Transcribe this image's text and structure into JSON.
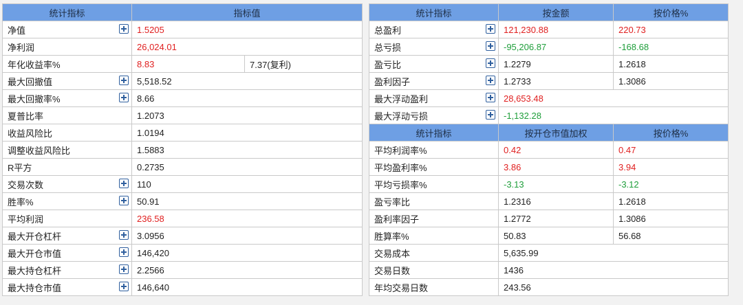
{
  "left": {
    "header": [
      "统计指标",
      "指标值"
    ],
    "rows": [
      {
        "label": "净值",
        "value": "1.5205",
        "color": "red",
        "expand": true
      },
      {
        "label": "净利润",
        "value": "26,024.01",
        "color": "red",
        "expand": false
      },
      {
        "label": "年化收益率%",
        "value": "8.83",
        "value2": "7.37(复利)",
        "color": "red",
        "expand": false
      },
      {
        "label": "最大回撤值",
        "value": "5,518.52",
        "expand": true
      },
      {
        "label": "最大回撤率%",
        "value": "8.66",
        "expand": true
      },
      {
        "label": "夏普比率",
        "value": "1.2073",
        "expand": false
      },
      {
        "label": "收益风险比",
        "value": "1.0194",
        "expand": false
      },
      {
        "label": "调整收益风险比",
        "value": "1.5883",
        "expand": false
      },
      {
        "label": "R平方",
        "value": "0.2735",
        "expand": false
      },
      {
        "label": "交易次数",
        "value": "110",
        "expand": true
      },
      {
        "label": "胜率%",
        "value": "50.91",
        "expand": true
      },
      {
        "label": "平均利润",
        "value": "236.58",
        "color": "red",
        "expand": false
      },
      {
        "label": "最大开仓杠杆",
        "value": "3.0956",
        "expand": true
      },
      {
        "label": "最大开仓市值",
        "value": "146,420",
        "expand": true
      },
      {
        "label": "最大持仓杠杆",
        "value": "2.2566",
        "expand": true
      },
      {
        "label": "最大持仓市值",
        "value": "146,640",
        "expand": true
      }
    ]
  },
  "right_top": {
    "header": [
      "统计指标",
      "按金额",
      "按价格%"
    ],
    "rows": [
      {
        "label": "总盈利",
        "v1": "121,230.88",
        "v2": "220.73",
        "color": "red",
        "expand": true
      },
      {
        "label": "总亏损",
        "v1": "-95,206.87",
        "v2": "-168.68",
        "color": "green",
        "expand": true
      },
      {
        "label": "盈亏比",
        "v1": "1.2279",
        "v2": "1.2618",
        "expand": true
      },
      {
        "label": "盈利因子",
        "v1": "1.2733",
        "v2": "1.3086",
        "expand": true
      },
      {
        "label": "最大浮动盈利",
        "v1": "28,653.48",
        "v2": "",
        "color": "red",
        "expand": true
      },
      {
        "label": "最大浮动亏损",
        "v1": "-1,132.28",
        "v2": "",
        "color": "green",
        "expand": true
      }
    ]
  },
  "right_bottom": {
    "header": [
      "统计指标",
      "按开仓市值加权",
      "按价格%"
    ],
    "rows": [
      {
        "label": "平均利润率%",
        "v1": "0.42",
        "v2": "0.47",
        "color": "red",
        "expand": false
      },
      {
        "label": "平均盈利率%",
        "v1": "3.86",
        "v2": "3.94",
        "color": "red",
        "expand": false
      },
      {
        "label": "平均亏损率%",
        "v1": "-3.13",
        "v2": "-3.12",
        "color": "green",
        "expand": false
      },
      {
        "label": "盈亏率比",
        "v1": "1.2316",
        "v2": "1.2618",
        "expand": false
      },
      {
        "label": "盈利率因子",
        "v1": "1.2772",
        "v2": "1.3086",
        "expand": false
      },
      {
        "label": "胜算率%",
        "v1": "50.83",
        "v2": "56.68",
        "expand": false
      },
      {
        "label": "交易成本",
        "v1": "5,635.99",
        "v2": "",
        "span": true,
        "expand": false
      },
      {
        "label": "交易日数",
        "v1": "1436",
        "v2": "",
        "span": true,
        "expand": false
      },
      {
        "label": "年均交易日数",
        "v1": "243.56",
        "v2": "",
        "span": true,
        "expand": false
      }
    ]
  },
  "colors": {
    "header_bg": "#6e9fe4",
    "positive": "#e02020",
    "negative": "#1e9e3a",
    "expand_icon": "#2f5f9e"
  }
}
